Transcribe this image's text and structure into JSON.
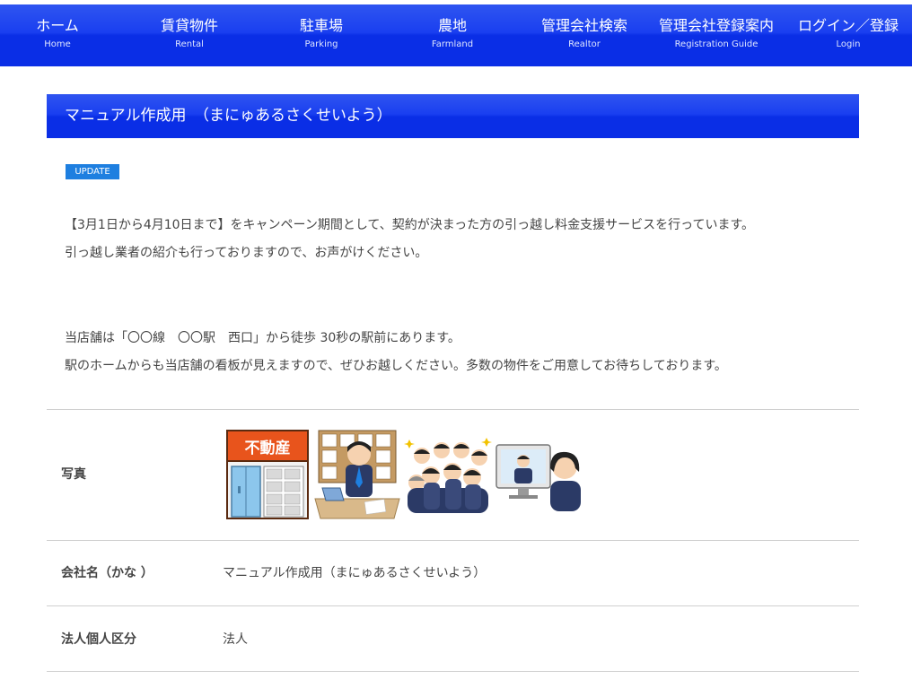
{
  "nav": {
    "items": [
      {
        "label": "ホーム",
        "sub": "Home"
      },
      {
        "label": "賃貸物件",
        "sub": "Rental"
      },
      {
        "label": "駐車場",
        "sub": "Parking"
      },
      {
        "label": "農地",
        "sub": "Farmland"
      },
      {
        "label": "管理会社検索",
        "sub": "Realtor"
      },
      {
        "label": "管理会社登録案内",
        "sub": "Registration Guide"
      },
      {
        "label": "ログイン／登録",
        "sub": "Login"
      }
    ]
  },
  "page": {
    "title": "マニュアル作成用　（まにゅあるさくせいよう）",
    "badge": "UPDATE",
    "paragraphs": [
      "【3月1日から4月10日まで】をキャンペーン期間として、契約が決まった方の引っ越し料金支援サービスを行っています。",
      "引っ越し業者の紹介も行っておりますので、お声がけください。",
      "当店舗は「〇〇線　〇〇駅　西口」から徒歩 30秒の駅前にあります。",
      "駅のホームからも当店舗の看板が見えますので、ぜひお越しください。多数の物件をご用意してお待ちしております。"
    ]
  },
  "details": {
    "photo_label": "写真",
    "shop_sign": "不動産",
    "rows": [
      {
        "label": "会社名（かな ）",
        "value": "マニュアル作成用（まにゅあるさくせいよう）"
      },
      {
        "label": "法人個人区分",
        "value": "法人"
      }
    ]
  },
  "colors": {
    "nav_blue": "#0a2ee6",
    "badge_blue": "#1e7fe0",
    "divider": "#cfcfcf"
  }
}
